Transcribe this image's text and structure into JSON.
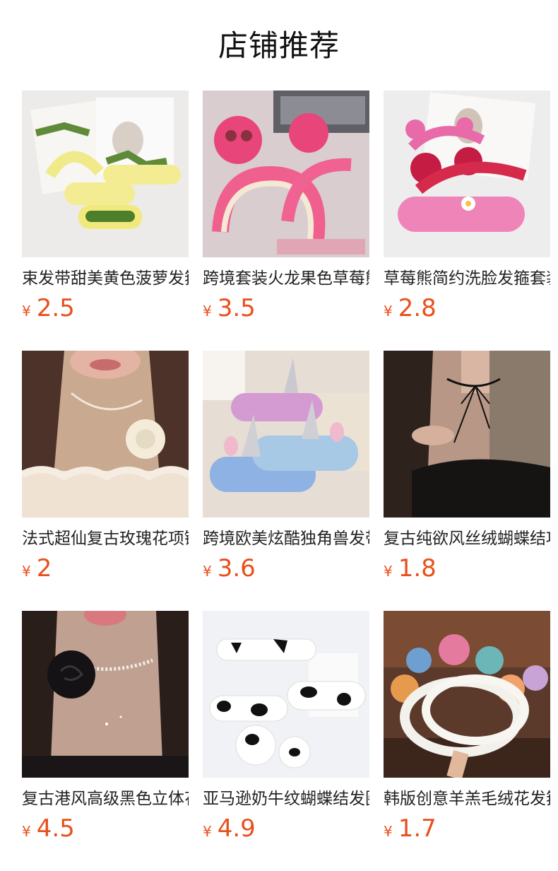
{
  "header": {
    "title": "店铺推荐"
  },
  "currency_symbol": "¥",
  "products": [
    {
      "name": "束发带甜美黄色菠萝发箍",
      "price": "2.5",
      "image": "pineapple-headbands-photo"
    },
    {
      "name": "跨境套装火龙果色草莓熊",
      "price": "3.5",
      "image": "strawberry-bear-headbands-photo"
    },
    {
      "name": "草莓熊简约洗脸发箍套装",
      "price": "2.8",
      "image": "pink-bear-ear-headbands-photo"
    },
    {
      "name": "法式超仙复古玫瑰花项链",
      "price": "2",
      "image": "rose-choker-photo"
    },
    {
      "name": "跨境欧美炫酷独角兽发带",
      "price": "3.6",
      "image": "unicorn-headbands-photo"
    },
    {
      "name": "复古纯欲风丝绒蝴蝶结项链",
      "price": "1.8",
      "image": "velvet-bow-choker-photo"
    },
    {
      "name": "复古港风高级黑色立体花",
      "price": "4.5",
      "image": "black-flower-choker-photo"
    },
    {
      "name": "亚马逊奶牛纹蝴蝶结发圈",
      "price": "4.9",
      "image": "cow-print-scrunchies-photo"
    },
    {
      "name": "韩版创意羊羔毛绒花发箍",
      "price": "1.7",
      "image": "plush-flower-headbands-photo"
    }
  ]
}
